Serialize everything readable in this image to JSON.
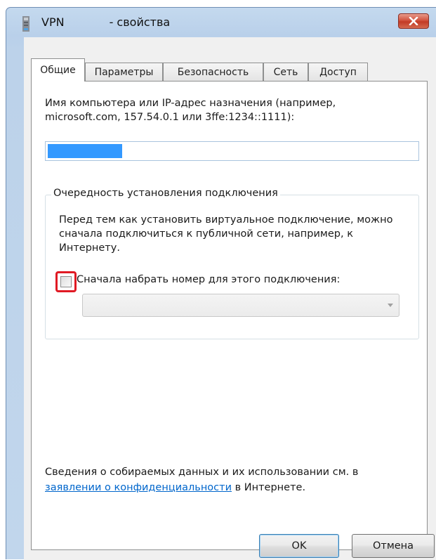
{
  "window": {
    "title_prefix": "VPN",
    "title_suffix": "- свойства"
  },
  "tabs": [
    {
      "label": "Общие",
      "active": true
    },
    {
      "label": "Параметры",
      "active": false
    },
    {
      "label": "Безопасность",
      "active": false
    },
    {
      "label": "Сеть",
      "active": false
    },
    {
      "label": "Доступ",
      "active": false
    }
  ],
  "general": {
    "host_description": "Имя компьютера или IP-адрес назначения (например, microsoft.com, 157.54.0.1 или 3ffe:1234::1111):",
    "host_value": "",
    "connection_group": {
      "legend": "Очередность установления подключения",
      "text": "Перед тем как установить виртуальное подключение, можно сначала подключиться к публичной сети, например, к Интернету.",
      "dial_first_label": "Сначала набрать номер для этого подключения:",
      "dial_first_checked": false,
      "dial_select_value": ""
    },
    "privacy": {
      "text_before": "Сведения о собираемых данных и их использовании см. в ",
      "link": "заявлении о конфиденциальности",
      "text_after": " в Интернете."
    }
  },
  "buttons": {
    "ok": "OK",
    "cancel": "Отмена"
  },
  "colors": {
    "selection": "#3399ff",
    "link": "#0066cc",
    "highlight": "#e01a24",
    "close_button": "#c23a25"
  },
  "icons": {
    "title": "network-connection-icon",
    "close": "close-icon",
    "dropdown": "chevron-down-icon"
  }
}
